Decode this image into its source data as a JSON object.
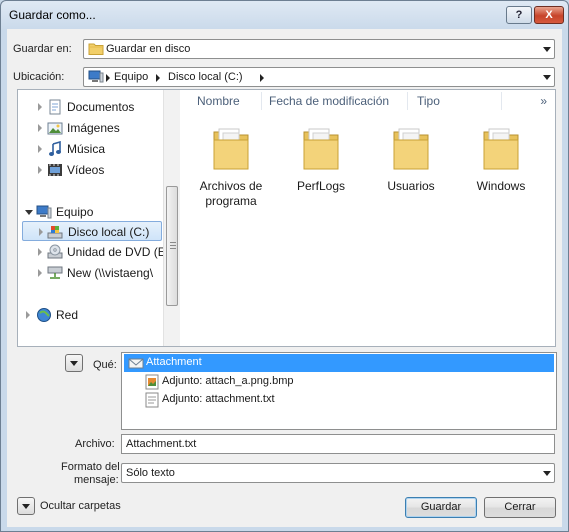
{
  "window": {
    "title": "Guardar como...",
    "help_label": "?",
    "close_label": "X"
  },
  "save_in": {
    "label": "Guardar en:",
    "value": "Guardar en disco"
  },
  "location": {
    "label": "Ubicación:",
    "segments": [
      "Equipo",
      "Disco local (C:)"
    ]
  },
  "nav": {
    "items": [
      {
        "label": "Documentos",
        "icon": "documents-icon"
      },
      {
        "label": "Imágenes",
        "icon": "pictures-icon"
      },
      {
        "label": "Música",
        "icon": "music-icon"
      },
      {
        "label": "Vídeos",
        "icon": "videos-icon"
      },
      {
        "label": "Equipo",
        "icon": "computer-icon"
      },
      {
        "label": "Disco local (C:)",
        "icon": "drive-icon"
      },
      {
        "label": "Unidad de DVD (E",
        "icon": "dvd-icon"
      },
      {
        "label": "New (\\\\vistaeng\\",
        "icon": "network-drive-icon"
      },
      {
        "label": "Red",
        "icon": "network-icon"
      }
    ]
  },
  "columns": {
    "name": "Nombre",
    "modified": "Fecha de modificación",
    "type": "Tipo",
    "more": "»"
  },
  "folders": [
    {
      "label": "Archivos de programa"
    },
    {
      "label": "PerfLogs"
    },
    {
      "label": "Usuarios"
    },
    {
      "label": "Windows"
    }
  ],
  "what": {
    "label": "Qué:",
    "items": [
      {
        "label": "Attachment",
        "icon": "envelope-icon",
        "selected": true
      },
      {
        "label": "Adjunto: attach_a.png.bmp",
        "icon": "image-file-icon",
        "selected": false
      },
      {
        "label": "Adjunto: attachment.txt",
        "icon": "text-file-icon",
        "selected": false
      }
    ]
  },
  "file": {
    "label": "Archivo:",
    "value": "Attachment.txt"
  },
  "format": {
    "label_line1": "Formato del",
    "label_line2": "mensaje:",
    "value": "Sólo texto"
  },
  "footer": {
    "hide_label": "Ocultar carpetas",
    "save_label": "Guardar",
    "close_label": "Cerrar"
  }
}
